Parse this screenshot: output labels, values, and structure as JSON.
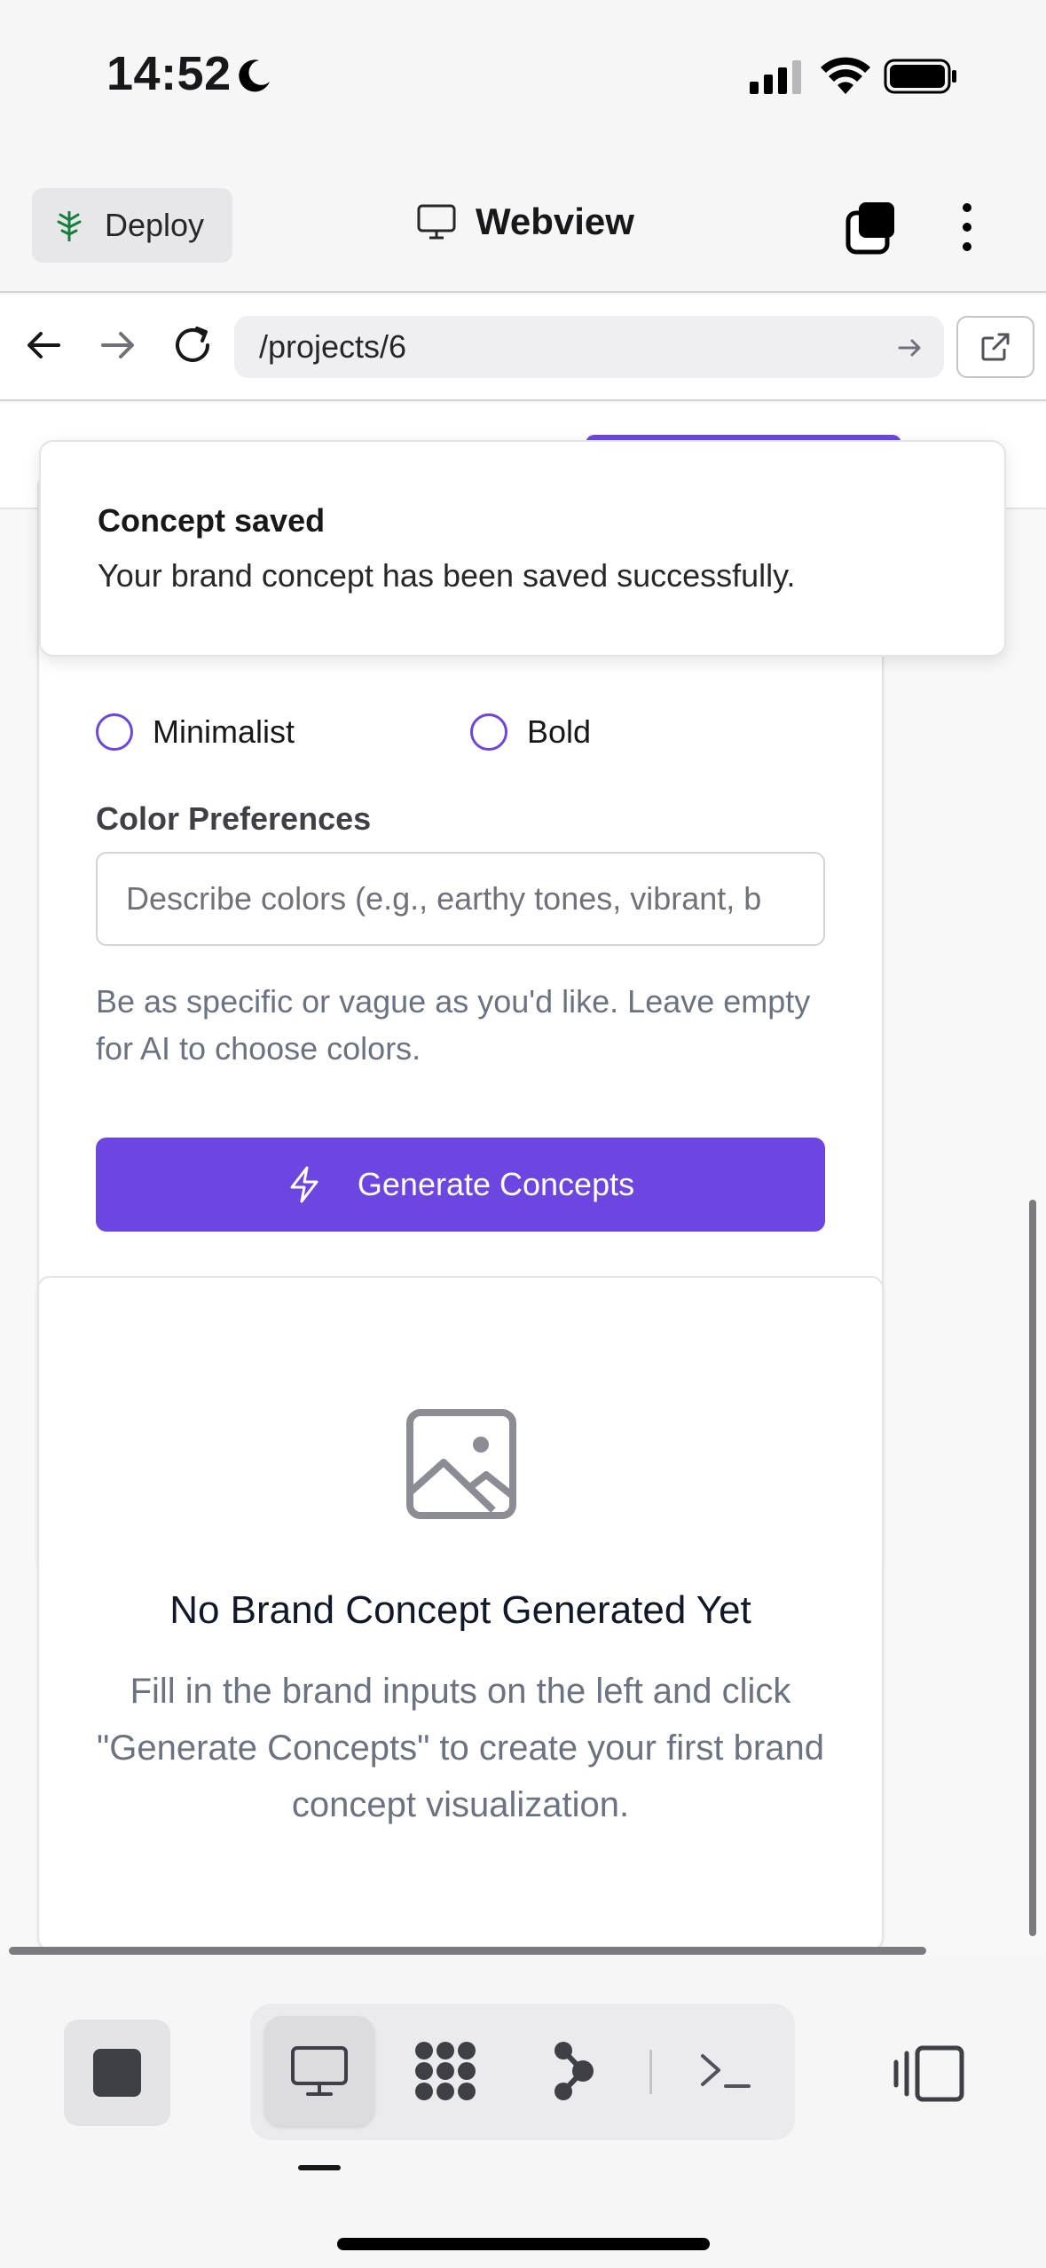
{
  "status_bar": {
    "time": "14:52",
    "icons": [
      "moon-icon",
      "signal-icon",
      "wifi-icon",
      "battery-icon"
    ]
  },
  "header": {
    "deploy_label": "Deploy",
    "title": "Webview",
    "icons": [
      "tree-icon",
      "monitor-icon",
      "tabs-icon",
      "more-icon"
    ]
  },
  "url_bar": {
    "url": "/projects/6",
    "icons": [
      "back-arrow-icon",
      "forward-arrow-icon",
      "reload-icon",
      "go-arrow-icon",
      "external-link-icon"
    ]
  },
  "toast": {
    "title": "Concept saved",
    "description": "Your brand concept has been saved successfully."
  },
  "form": {
    "style_options": [
      {
        "label": "Minimalist",
        "selected": false
      },
      {
        "label": "Bold",
        "selected": false
      }
    ],
    "color_label": "Color Preferences",
    "color_placeholder": "Describe colors (e.g., earthy tones, vibrant, b",
    "color_help": "Be as specific or vague as you'd like. Leave empty for AI to choose colors.",
    "generate_label": "Generate Concepts"
  },
  "empty_state": {
    "title": "No Brand Concept Generated Yet",
    "text": "Fill in the brand inputs on the left and click \"Generate Concepts\" to create your first brand concept visualization."
  },
  "bottom_toolbar": {
    "tools": [
      "stop-icon",
      "desktop-icon",
      "grid-icon",
      "branch-icon",
      "terminal-icon",
      "panel-toggle-icon"
    ],
    "active_tool": "desktop-icon"
  },
  "colors": {
    "accent": "#6d45e0",
    "text": "#18181b",
    "muted": "#6b7280",
    "border": "#e4e4e7"
  }
}
